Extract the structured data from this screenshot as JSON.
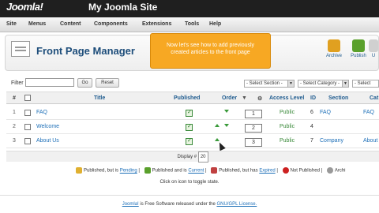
{
  "brand": {
    "logo": "Joomla!",
    "site_name": "My Joomla Site"
  },
  "menu": [
    "Site",
    "Menus",
    "Content",
    "Components",
    "Extensions",
    "Tools",
    "Help"
  ],
  "page": {
    "title": "Front Page Manager"
  },
  "tooltip": {
    "text": "Now let's see how to add previously created articles to the front page"
  },
  "toolbar": [
    {
      "label": "Archive",
      "icon": "archive-icon",
      "color": "#e0a020"
    },
    {
      "label": "Publish",
      "icon": "publish-icon",
      "color": "#5aa02c"
    },
    {
      "label": "U",
      "icon": "unpublish-icon",
      "color": "#d0d0d0"
    }
  ],
  "filter": {
    "label": "Filter",
    "value": "",
    "go": "Go",
    "reset": "Reset",
    "section": "- Select Section -",
    "category": "- Select Category -",
    "author": "- Select"
  },
  "table": {
    "headers": {
      "num": "#",
      "title": "Title",
      "published": "Published",
      "order": "Order",
      "access": "Access Level",
      "id": "ID",
      "section": "Section",
      "category": "Cat"
    },
    "rows": [
      {
        "num": "1",
        "title": "FAQ",
        "order": "1",
        "access": "Public",
        "id": "6",
        "section": "FAQ",
        "category": "FAQ"
      },
      {
        "num": "2",
        "title": "Welcome",
        "order": "2",
        "access": "Public",
        "id": "4",
        "section": "",
        "category": ""
      },
      {
        "num": "3",
        "title": "About Us",
        "order": "3",
        "access": "Public",
        "id": "7",
        "section": "Company",
        "category": "About"
      }
    ]
  },
  "display": {
    "label": "Display #",
    "value": "20"
  },
  "legend": {
    "p1": "Published, but is",
    "pending": "Pending",
    "p2": "Published and is",
    "current": "Current",
    "p3": "Published, but has",
    "expired": "Expired",
    "p4": "Not Published",
    "p5": "Archi"
  },
  "hint": "Click on icon to toggle state.",
  "footer": {
    "pre": "Joomla!",
    "mid": "is Free Software released under the",
    "license": "GNU/GPL License."
  }
}
